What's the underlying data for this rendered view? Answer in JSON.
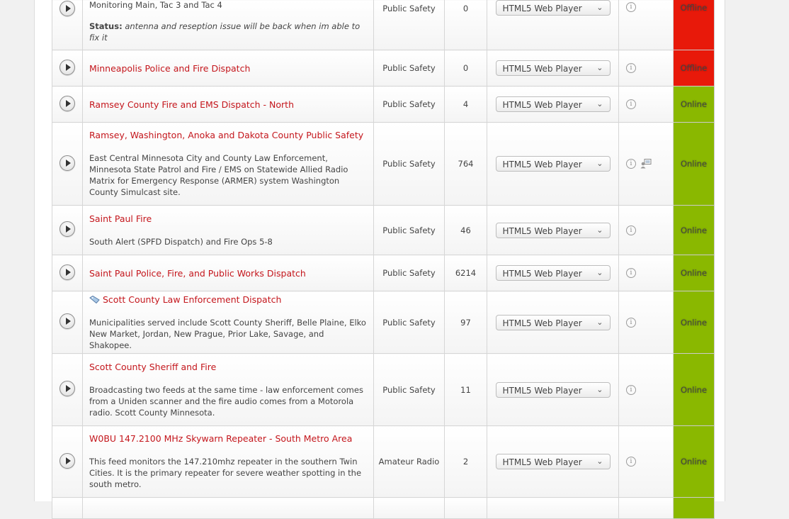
{
  "player_label": "HTML5 Web Player",
  "colors": {
    "offline": "#e8190a",
    "online": "#8ab800",
    "link": "#c4161c"
  },
  "icons": {
    "play": "play-button-icon",
    "info": "info-icon",
    "dispatch": "dispatch-console-icon",
    "tag": "tag-icon",
    "dropdown": "chevron-down-icon"
  },
  "rows": [
    {
      "title": "",
      "top_text": "Monitoring Main, Tac 3 and Tac 4",
      "status_label": "Status:",
      "status_note": "antenna and reseption issue will be back when im able to fix it",
      "genre": "Public Safety",
      "listeners": "0",
      "status": "Offline"
    },
    {
      "title": "Minneapolis Police and Fire Dispatch",
      "genre": "Public Safety",
      "listeners": "0",
      "status": "Offline"
    },
    {
      "title": "Ramsey County Fire and EMS Dispatch - North",
      "genre": "Public Safety",
      "listeners": "4",
      "status": "Online"
    },
    {
      "title": "Ramsey, Washington, Anoka and Dakota County Public Safety",
      "description": "East Central Minnesota City and County Law Enforcement, Minnesota State Patrol and Fire / EMS on Statewide Allied Radio Matrix for Emergency Response (ARMER) system Washington County Simulcast site.",
      "genre": "Public Safety",
      "listeners": "764",
      "status": "Online"
    },
    {
      "title": "Saint Paul Fire",
      "description": "South Alert (SPFD Dispatch) and Fire Ops 5-8",
      "genre": "Public Safety",
      "listeners": "46",
      "status": "Online"
    },
    {
      "title": "Saint Paul Police, Fire, and Public Works Dispatch",
      "genre": "Public Safety",
      "listeners": "6214",
      "status": "Online"
    },
    {
      "title": "Scott County Law Enforcement Dispatch",
      "description": "Municipalities served include Scott County Sheriff, Belle Plaine, Elko New Market, Jordan, New Prague, Prior Lake, Savage, and Shakopee.",
      "genre": "Public Safety",
      "listeners": "97",
      "status": "Online"
    },
    {
      "title": "Scott County Sheriff and Fire",
      "description": "Broadcasting two feeds at the same time - law enforcement comes from a Uniden scanner and the fire audio comes from a Motorola radio. Scott County Minnesota.",
      "genre": "Public Safety",
      "listeners": "11",
      "status": "Online"
    },
    {
      "title": "W0BU 147.2100 MHz Skywarn Repeater - South Metro Area",
      "description": "This feed monitors the 147.210mhz repeater in the southern Twin Cities. It is the primary repeater for severe weather spotting in the south metro.",
      "genre": "Amateur Radio",
      "listeners": "2",
      "status": "Online"
    }
  ]
}
